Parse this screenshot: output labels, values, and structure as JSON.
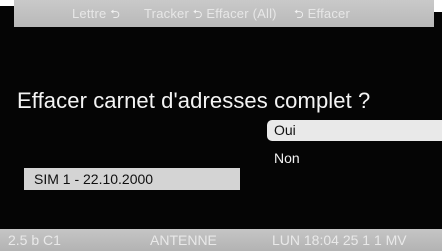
{
  "top_bar": {
    "softkey_1": "Lettre",
    "softkey_1_icon": "return-arrow-icon",
    "softkey_2": "Tracker",
    "softkey_2_icon": "return-arrow-icon",
    "softkey_2_extra": "Effacer (All)",
    "softkey_3": "Effacer",
    "softkey_3_icon": "return-arrow-icon"
  },
  "dialog": {
    "title": "Effacer carnet d'adresses complet ?",
    "options": [
      "Oui",
      "Non"
    ],
    "selected_option": "Oui"
  },
  "sim_entry": "SIM 1 - 22.10.2000",
  "status_bar": {
    "signal": "2.5 b C1",
    "operator": "ANTENNE",
    "datetime": "LUN 18:04 25 1 1 MV"
  },
  "colors": {
    "background": "#050505",
    "bar": "#c0c0c0",
    "selected": "#e9e9e9"
  }
}
